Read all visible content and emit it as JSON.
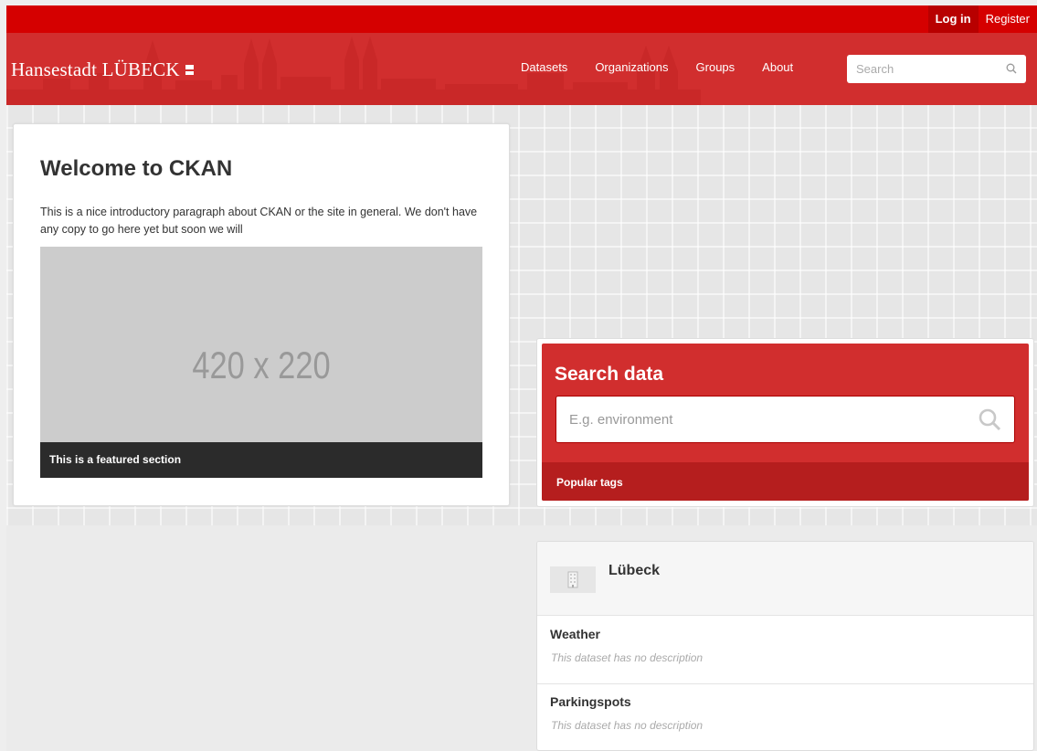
{
  "account": {
    "login_label": "Log in",
    "register_label": "Register"
  },
  "header": {
    "brand": "Hansestadt LÜBECK",
    "nav": [
      {
        "label": "Datasets"
      },
      {
        "label": "Organizations"
      },
      {
        "label": "Groups"
      },
      {
        "label": "About"
      }
    ],
    "search_placeholder": "Search"
  },
  "welcome": {
    "title": "Welcome to CKAN",
    "intro": "This is a nice introductory paragraph about CKAN or the site in general. We don't have any copy to go here yet but soon we will",
    "placeholder_image_text": "420 x 220",
    "featured_caption": "This is a featured section"
  },
  "search_data": {
    "title": "Search data",
    "placeholder": "E.g. environment",
    "popular_tags_label": "Popular tags"
  },
  "organization": {
    "name": "Lübeck",
    "datasets": [
      {
        "title": "Weather",
        "description": "This dataset has no description"
      },
      {
        "title": "Parkingspots",
        "description": "This dataset has no description"
      }
    ]
  },
  "colors": {
    "account_bar": "#d50000",
    "masthead": "#d12e2e",
    "popular_tags": "#b51e1e"
  }
}
